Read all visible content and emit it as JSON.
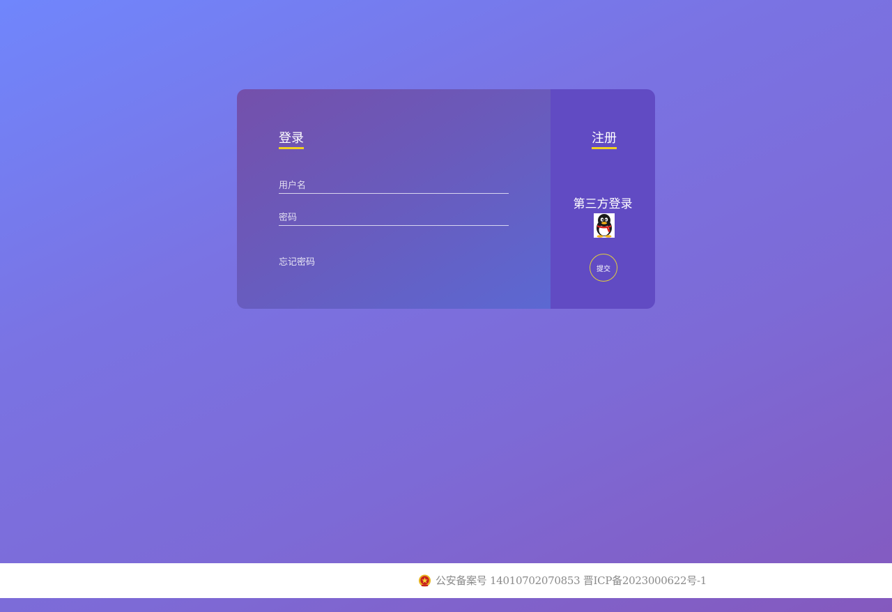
{
  "login": {
    "title": "登录",
    "username_placeholder": "用户名",
    "password_placeholder": "密码",
    "forgot_label": "忘记密码"
  },
  "register": {
    "title": "注册",
    "third_party_label": "第三方登录",
    "qq_icon": "qq-penguin-icon",
    "submit_label": "提交"
  },
  "footer": {
    "police_icon": "police-badge-icon",
    "record_text": "公安备案号 14010702070853 晋ICP备2023000622号-1"
  },
  "colors": {
    "accent_underline": "#f2d21f",
    "left_panel": "#6a5abb",
    "right_panel": "#614bc3"
  }
}
